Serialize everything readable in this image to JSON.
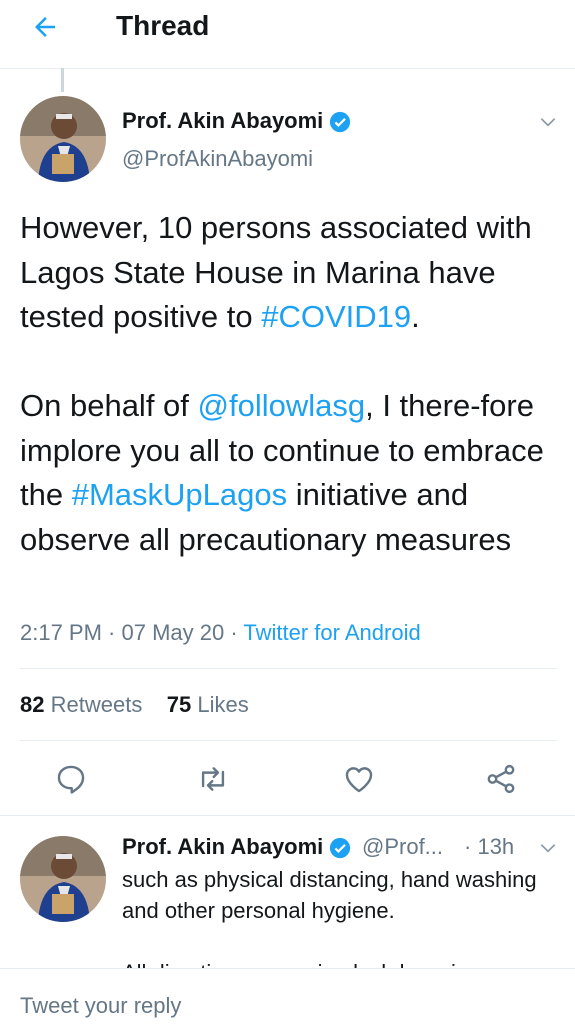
{
  "header": {
    "title": "Thread",
    "back_icon": "arrow-left-icon"
  },
  "main_tweet": {
    "author": {
      "name": "Prof. Akin Abayomi",
      "handle": "@ProfAkinAbayomi",
      "verified": true
    },
    "text": {
      "para1_start": "However, 10 persons associated with Lagos State House in Marina have tested positive to ",
      "para1_hashtag": "#COVID19",
      "para1_end": ".",
      "para2_start": "On behalf of ",
      "para2_mention": "@followlasg",
      "para2_mid": ", I there-fore implore you all to continue to embrace the ",
      "para2_hashtag": "#MaskUpLagos",
      "para2_end": " initiative and observe all precautionary measures"
    },
    "time": "2:17 PM",
    "date": "07 May 20",
    "source": "Twitter for Android",
    "retweets_count": "82",
    "retweets_label": "Retweets",
    "likes_count": "75",
    "likes_label": "Likes"
  },
  "reply_tweet": {
    "author": {
      "name": "Prof. Akin Abayomi",
      "handle": "@Prof...",
      "verified": true
    },
    "age": "13h",
    "text_line1": "such as physical distancing, hand washing and other personal hygiene.",
    "text_line2": "All directives on easing lockdown in"
  },
  "composer": {
    "placeholder": "Tweet your reply"
  },
  "colors": {
    "accent": "#1da1f2",
    "secondary_text": "#657786",
    "primary_text": "#14171a",
    "divider": "#e6ecf0"
  }
}
